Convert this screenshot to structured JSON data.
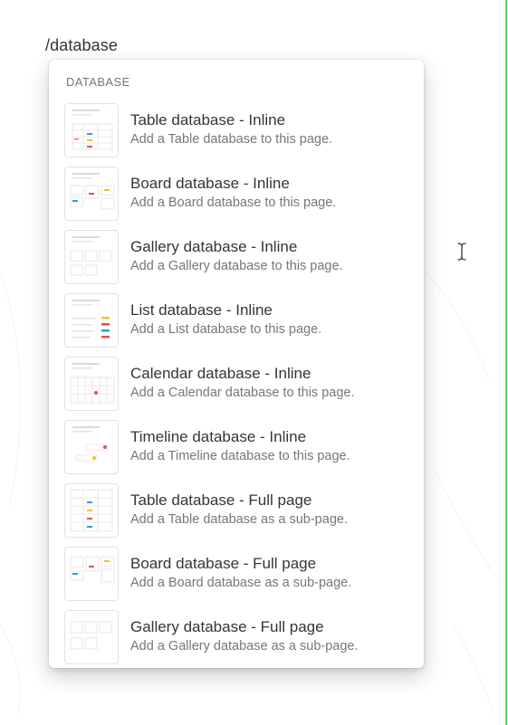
{
  "editor": {
    "slash_command": "/database"
  },
  "menu": {
    "section_label": "DATABASE",
    "items": [
      {
        "title": "Table database - Inline",
        "description": "Add a Table database to this page.",
        "icon": "table-thumbnail-icon"
      },
      {
        "title": "Board database - Inline",
        "description": "Add a Board database to this page.",
        "icon": "board-thumbnail-icon"
      },
      {
        "title": "Gallery database - Inline",
        "description": "Add a Gallery database to this page.",
        "icon": "gallery-thumbnail-icon"
      },
      {
        "title": "List database - Inline",
        "description": "Add a List database to this page.",
        "icon": "list-thumbnail-icon"
      },
      {
        "title": "Calendar database - Inline",
        "description": "Add a Calendar database to this page.",
        "icon": "calendar-thumbnail-icon"
      },
      {
        "title": "Timeline database - Inline",
        "description": "Add a Timeline database to this page.",
        "icon": "timeline-thumbnail-icon"
      },
      {
        "title": "Table database - Full page",
        "description": "Add a Table database as a sub-page.",
        "icon": "table-thumbnail-icon"
      },
      {
        "title": "Board database - Full page",
        "description": "Add a Board database as a sub-page.",
        "icon": "board-thumbnail-icon"
      },
      {
        "title": "Gallery database - Full page",
        "description": "Add a Gallery database as a sub-page.",
        "icon": "gallery-thumbnail-icon"
      }
    ]
  },
  "colors": {
    "accent_green": "#5bd65b",
    "tag_blue": "#2e9bd6",
    "tag_red": "#e2524a",
    "tag_yellow": "#f2c230",
    "text_primary": "#37352f",
    "text_secondary": "#787774"
  }
}
